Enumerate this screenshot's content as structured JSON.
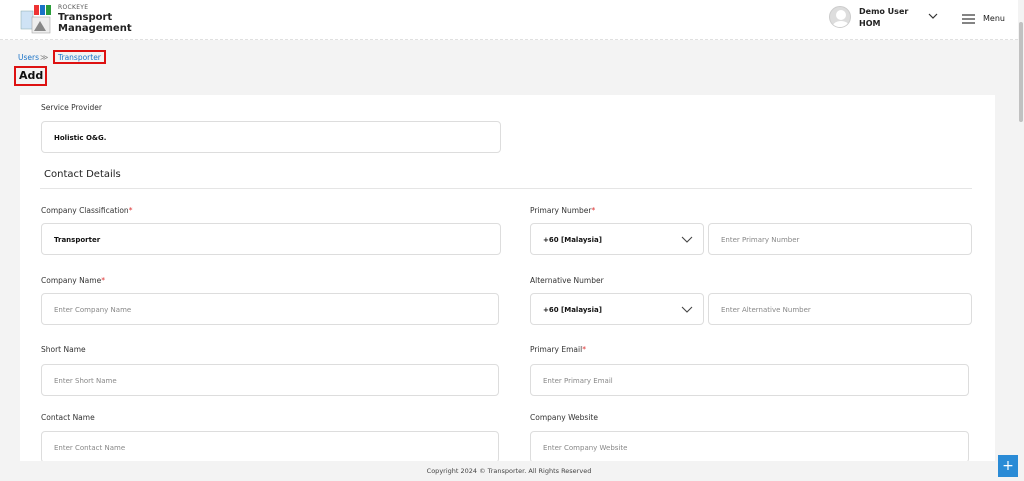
{
  "header": {
    "brand_small": "ROCKEYE",
    "brand_line1": "Transport",
    "brand_line2": "Management",
    "user_name": "Demo User",
    "user_role": "HOM",
    "menu_label": "Menu"
  },
  "breadcrumb": {
    "users": "Users",
    "separator": "≫",
    "current": "Transporter"
  },
  "page_title": "Add",
  "form": {
    "service_provider": {
      "label": "Service Provider",
      "value": "Holistic O&G."
    },
    "section_title": "Contact Details",
    "company_classification": {
      "label": "Company Classification",
      "required": "*",
      "value": "Transporter"
    },
    "company_name": {
      "label": "Company Name",
      "required": "*",
      "placeholder": "Enter Company Name"
    },
    "short_name": {
      "label": "Short Name",
      "placeholder": "Enter Short Name"
    },
    "contact_name": {
      "label": "Contact Name",
      "placeholder": "Enter Contact Name"
    },
    "primary_number": {
      "label": "Primary Number",
      "required": "*",
      "country": "+60 [Malaysia]",
      "placeholder": "Enter Primary Number"
    },
    "alternative_number": {
      "label": "Alternative Number",
      "country": "+60 [Malaysia]",
      "placeholder": "Enter Alternative Number"
    },
    "primary_email": {
      "label": "Primary Email",
      "required": "*",
      "placeholder": "Enter Primary Email"
    },
    "company_website": {
      "label": "Company Website",
      "placeholder": "Enter Company Website"
    }
  },
  "footer": "Copyright 2024 © Transporter. All Rights Reserved",
  "fab_label": "+",
  "colors": {
    "accent": "#2a8bd6",
    "highlight": "#dd1111",
    "required": "#dd3333"
  }
}
